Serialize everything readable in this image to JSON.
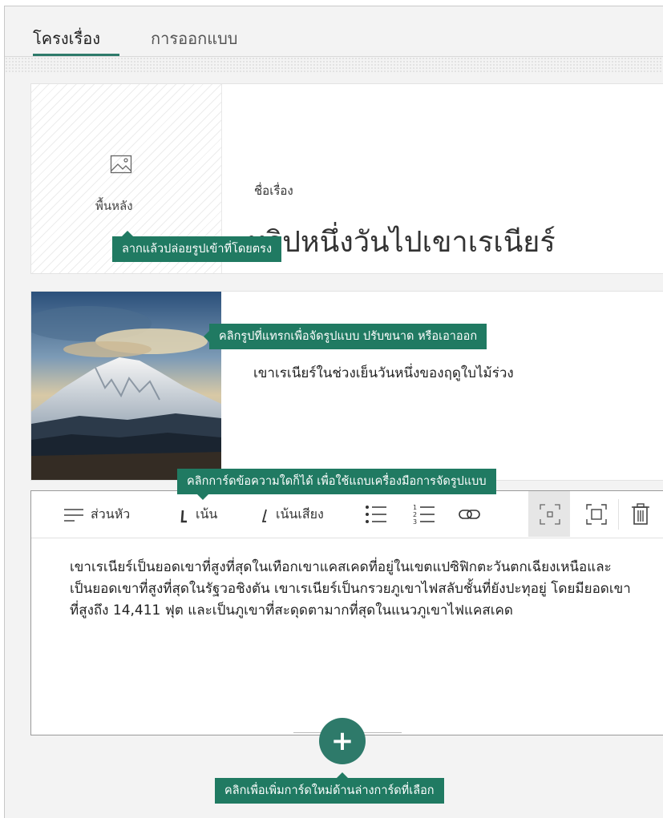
{
  "tabs": [
    {
      "label": "โครงเรื่อง",
      "active": true
    },
    {
      "label": "การออกแบบ",
      "active": false
    }
  ],
  "title_card": {
    "background_label": "พื้นหลัง",
    "title_label": "ชื่อเรื่อง",
    "title_text": "ทริปหนึ่งวันไปเขาเรเนียร์"
  },
  "image_card": {
    "caption": "เขาเรเนียร์ในช่วงเย็นวันหนึ่งของฤดูใบไม้ร่วง"
  },
  "text_card": {
    "toolbar": {
      "heading_label": "ส่วนหัว",
      "emphasis_label": "เน้น",
      "accent_label": "เน้นเสียง",
      "icons": [
        "bullet-list-icon",
        "numbered-list-icon",
        "link-icon",
        "focus-small-icon",
        "focus-large-icon",
        "delete-icon"
      ]
    },
    "body": "เขาเรเนียร์เป็นยอดเขาที่สูงที่สุดในเทือกเขาแคสเคดที่อยู่ในเขตแปซิฟิกตะวันตกเฉียงเหนือและเป็นยอดเขาที่สูงที่สุดในรัฐวอชิงตัน เขาเรเนียร์เป็นกรวยภูเขาไฟสลับชั้นที่ยังปะทุอยู่ โดยมียอดเขาที่สูงถึง 14,411 ฟุต และเป็นภูเขาที่สะดุดตามากที่สุดในแนวภูเขาไฟแคสเคด"
  },
  "tooltips": {
    "drag_drop": "ลากแล้วปล่อยรูปเข้าที่โดยตรง",
    "click_image": "คลิกรูปที่แทรกเพื่อจัดรูปแบบ ปรับขนาด หรือเอาออก",
    "click_text_card": "คลิกการ์ดข้อความใดก็ได้ เพื่อใช้แถบเครื่องมือการจัดรูปแบบ",
    "add_card": "คลิกเพื่อเพิ่มการ์ดใหม่ด้านล่างการ์ดที่เลือก"
  },
  "add_button_symbol": "+",
  "colors": {
    "accent": "#2e7a6a",
    "tooltip": "#207a62"
  }
}
